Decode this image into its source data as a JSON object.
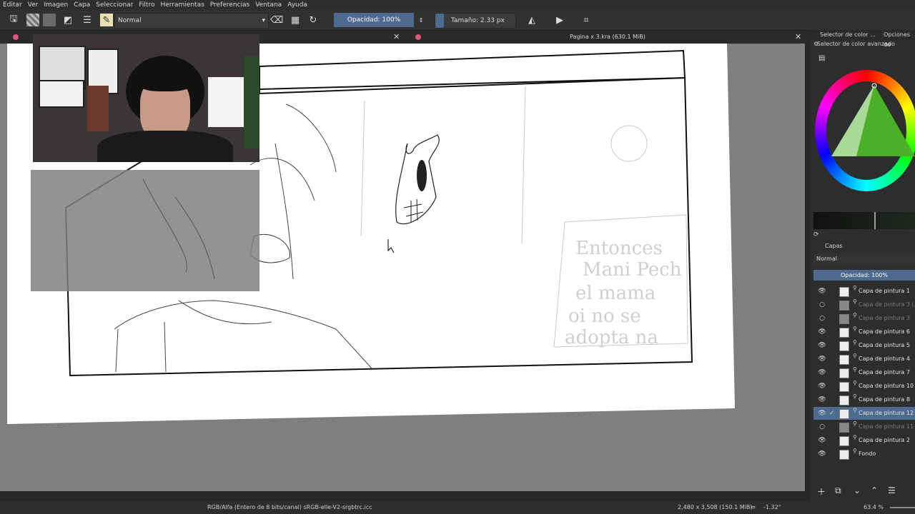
{
  "menu": [
    "Editar",
    "Ver",
    "Imagen",
    "Capa",
    "Seleccionar",
    "Filtro",
    "Herramientas",
    "Preferencias",
    "Ventana",
    "Ayuda"
  ],
  "toolbar": {
    "blend_mode": "Normal",
    "opacity": "Opacidad: 100%",
    "size": "Tamaño: 2.33 px"
  },
  "document_tab": "Pagina x 3.kra (630.1 MiB)",
  "right_panel": {
    "tabs": [
      "Selector de color ...",
      "Opciones de"
    ],
    "color_title": "Selector de color avanzado",
    "layers_title": "Capas",
    "layers_blend": "Normal",
    "layers_opacity": "Opacidad: 100%",
    "layers": [
      {
        "name": "Capa de pintura 1",
        "visible": true
      },
      {
        "name": "Capa de pintura 3 (...",
        "visible": false
      },
      {
        "name": "Capa de pintura 3",
        "visible": false
      },
      {
        "name": "Capa de pintura 6",
        "visible": true
      },
      {
        "name": "Capa de pintura 5",
        "visible": true
      },
      {
        "name": "Capa de pintura 4",
        "visible": true
      },
      {
        "name": "Capa de pintura 7",
        "visible": true
      },
      {
        "name": "Capa de pintura 10",
        "visible": true
      },
      {
        "name": "Capa de pintura 8",
        "visible": true
      },
      {
        "name": "Capa de pintura 12",
        "visible": true,
        "selected": true
      },
      {
        "name": "Capa de pintura 11",
        "visible": false
      },
      {
        "name": "Capa de pintura 2",
        "visible": true
      },
      {
        "name": "Fondo",
        "visible": true
      }
    ]
  },
  "canvas_text": [
    "Entonces",
    "Mani Pech",
    "el mama",
    "oi no se",
    "adopta na"
  ],
  "status": {
    "colorspace": "RGB/Alfa (Entero de 8 bits/canal)  sRGB-elle-V2-srgbtrc.icc",
    "dimensions": "2,480 x 3,508 (150.1 MiB)",
    "rotation": "-1.32°",
    "zoom": "63.4 %"
  }
}
